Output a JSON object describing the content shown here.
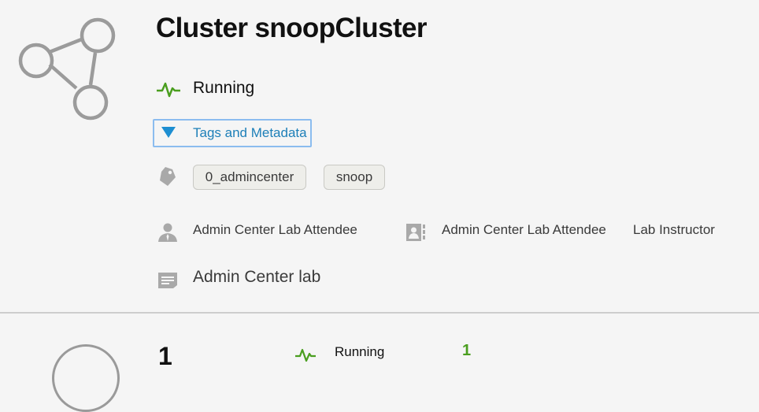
{
  "header": {
    "title": "Cluster snoopCluster",
    "status": "Running",
    "status_color": "#4a9e1f"
  },
  "tags_section": {
    "toggle_label": "Tags and Metadata",
    "accent_color": "#1d8ed1",
    "tags": [
      "0_admincenter",
      "snoop"
    ]
  },
  "metadata": {
    "owner": "Admin Center Lab Attendee",
    "contact_name": "Admin Center Lab Attendee",
    "contact_role": "Lab Instructor",
    "note": "Admin Center lab"
  },
  "list_row": {
    "number": "1",
    "status": "Running",
    "count": "1"
  }
}
